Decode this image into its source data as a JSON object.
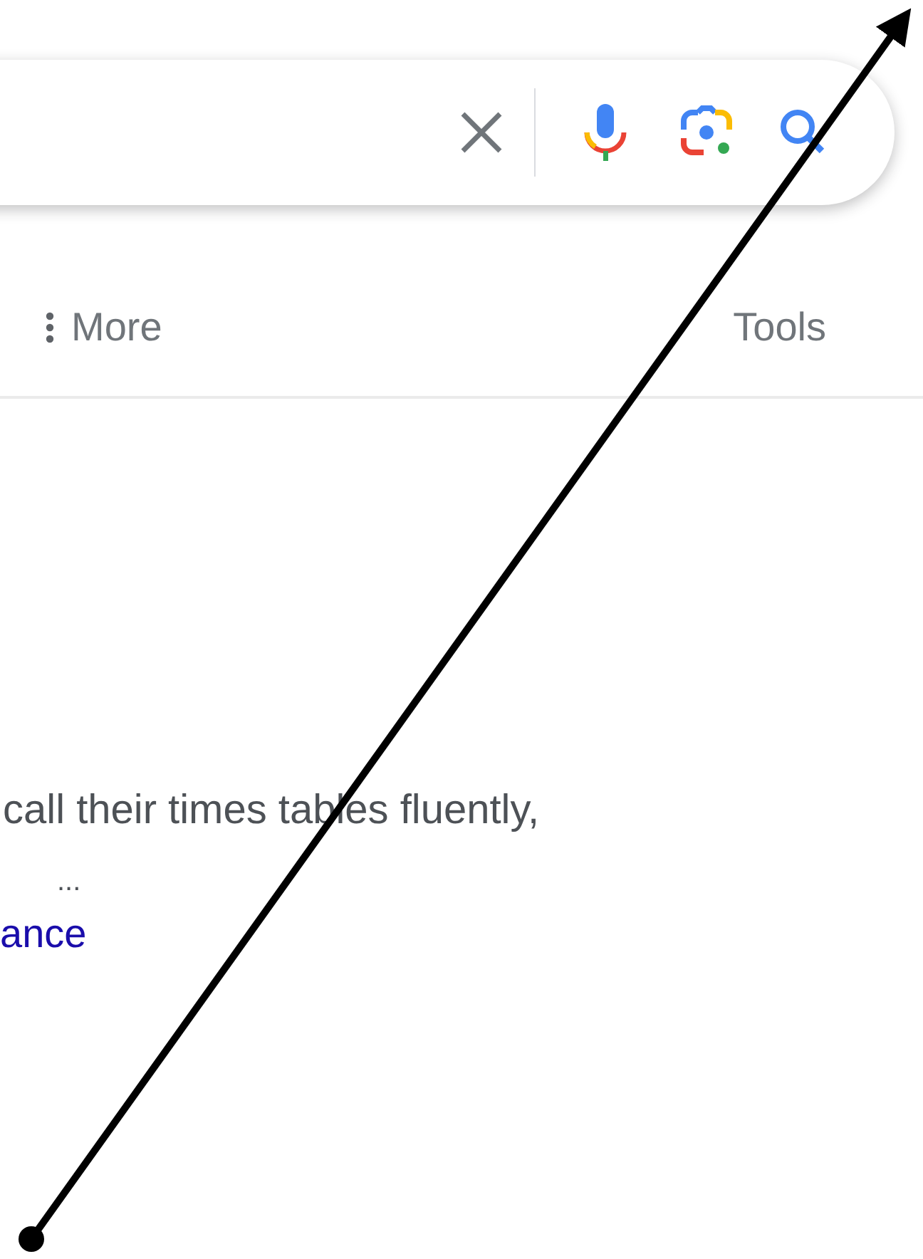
{
  "search_bar": {
    "actions": [
      {
        "kind": "clear"
      },
      {
        "kind": "divider"
      },
      {
        "kind": "voice"
      },
      {
        "kind": "lens"
      },
      {
        "kind": "search"
      }
    ]
  },
  "nav": {
    "more": "More",
    "tools": "Tools"
  },
  "result": {
    "snippet_lines": [
      "call their times tables fluently,",
      "..."
    ],
    "link": "ance"
  },
  "annotation": {
    "kind": "arrow"
  }
}
